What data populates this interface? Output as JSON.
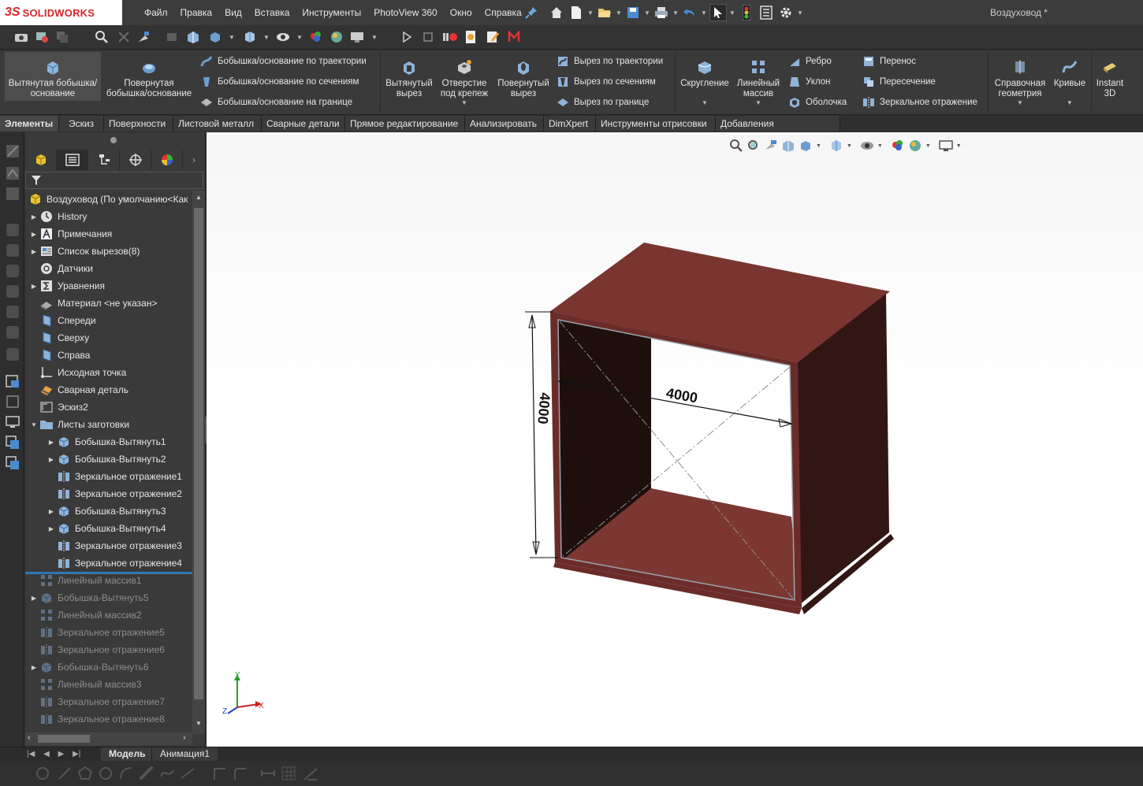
{
  "app": {
    "logo_ds": "3S",
    "logo_text": "SOLIDWORKS",
    "document_title": "Воздуховод *"
  },
  "menu": [
    "Файл",
    "Правка",
    "Вид",
    "Вставка",
    "Инструменты",
    "PhotoView 360",
    "Окно",
    "Справка"
  ],
  "ribbon": {
    "extrude_boss": "Вытянутая бобышка/основание",
    "revolve_boss": "Повернутая бобышка/основание",
    "sweep_boss": "Бобышка/основание по траектории",
    "loft_boss": "Бобышка/основание по сечениям",
    "boundary_boss": "Бобышка/основание на границе",
    "extrude_cut": "Вытянутый вырез",
    "hole_wizard": "Отверстие под крепеж",
    "revolve_cut": "Повернутый вырез",
    "sweep_cut": "Вырез по траектории",
    "loft_cut": "Вырез по сечениям",
    "boundary_cut": "Вырез по границе",
    "fillet": "Скругление",
    "linear_pattern": "Линейный массив",
    "rib": "Ребро",
    "draft": "Уклон",
    "shell": "Оболочка",
    "wrap": "Перенос",
    "intersect": "Пересечение",
    "mirror": "Зеркальное отражение",
    "ref_geometry": "Справочная геометрия",
    "curves": "Кривые",
    "instant3d": "Instant 3D"
  },
  "tabs": [
    "Элементы",
    "Эскиз",
    "Поверхности",
    "Листовой металл",
    "Сварные детали",
    "Прямое редактирование",
    "Анализировать",
    "DimXpert",
    "Инструменты отрисовки",
    "Добавления SOLIDWORKS"
  ],
  "tree": {
    "root": "Воздуховод  (По умолчанию<Как",
    "items": [
      {
        "label": "History",
        "arrow": "▶",
        "icon": "history-icon",
        "dim": false
      },
      {
        "label": "Примечания",
        "arrow": "▶",
        "icon": "annotations-icon",
        "dim": false
      },
      {
        "label": "Список вырезов(8)",
        "arrow": "▶",
        "icon": "cut-list-icon",
        "dim": false
      },
      {
        "label": "Датчики",
        "arrow": "",
        "icon": "sensors-icon",
        "dim": false
      },
      {
        "label": "Уравнения",
        "arrow": "▶",
        "icon": "equations-icon",
        "dim": false
      },
      {
        "label": "Материал <не указан>",
        "arrow": "",
        "icon": "material-icon",
        "dim": false
      },
      {
        "label": "Спереди",
        "arrow": "",
        "icon": "plane-icon",
        "dim": false
      },
      {
        "label": "Сверху",
        "arrow": "",
        "icon": "plane-icon",
        "dim": false
      },
      {
        "label": "Справа",
        "arrow": "",
        "icon": "plane-icon",
        "dim": false
      },
      {
        "label": "Исходная точка",
        "arrow": "",
        "icon": "origin-icon",
        "dim": false
      },
      {
        "label": "Сварная деталь",
        "arrow": "",
        "icon": "weldment-icon",
        "dim": false
      },
      {
        "label": "Эскиз2",
        "arrow": "",
        "icon": "sketch-icon",
        "dim": false
      },
      {
        "label": "Листы заготовки",
        "arrow": "▼",
        "icon": "folder-icon",
        "dim": false
      },
      {
        "label": "Бобышка-Вытянуть1",
        "arrow": "▶",
        "icon": "extrude-icon",
        "dim": false,
        "indent": true
      },
      {
        "label": "Бобышка-Вытянуть2",
        "arrow": "▶",
        "icon": "extrude-icon",
        "dim": false,
        "indent": true
      },
      {
        "label": "Зеркальное отражение1",
        "arrow": "",
        "icon": "mirror-icon",
        "dim": false,
        "indent": true
      },
      {
        "label": "Зеркальное отражение2",
        "arrow": "",
        "icon": "mirror-icon",
        "dim": false,
        "indent": true
      },
      {
        "label": "Бобышка-Вытянуть3",
        "arrow": "▶",
        "icon": "extrude-icon",
        "dim": false,
        "indent": true
      },
      {
        "label": "Бобышка-Вытянуть4",
        "arrow": "▶",
        "icon": "extrude-icon",
        "dim": false,
        "indent": true
      },
      {
        "label": "Зеркальное отражение3",
        "arrow": "",
        "icon": "mirror-icon",
        "dim": false,
        "indent": true
      },
      {
        "label": "Зеркальное отражение4",
        "arrow": "",
        "icon": "mirror-icon",
        "dim": false,
        "indent": true
      },
      {
        "label": "Линейный массив1",
        "arrow": "",
        "icon": "pattern-icon",
        "dim": true
      },
      {
        "label": "Бобышка-Вытянуть5",
        "arrow": "▶",
        "icon": "extrude-icon",
        "dim": true
      },
      {
        "label": "Линейный массив2",
        "arrow": "",
        "icon": "pattern-icon",
        "dim": true
      },
      {
        "label": "Зеркальное отражение5",
        "arrow": "",
        "icon": "mirror-icon",
        "dim": true
      },
      {
        "label": "Зеркальное отражение6",
        "arrow": "",
        "icon": "mirror-icon",
        "dim": true
      },
      {
        "label": "Бобышка-Вытянуть6",
        "arrow": "▶",
        "icon": "extrude-icon",
        "dim": true
      },
      {
        "label": "Линейный массив3",
        "arrow": "",
        "icon": "pattern-icon",
        "dim": true
      },
      {
        "label": "Зеркальное отражение7",
        "arrow": "",
        "icon": "mirror-icon",
        "dim": true
      },
      {
        "label": "Зеркальное отражение8",
        "arrow": "",
        "icon": "mirror-icon",
        "dim": true
      }
    ]
  },
  "model": {
    "dim_horizontal": "4000",
    "dim_vertical": "4000",
    "axis_x": "X",
    "axis_y": "Y",
    "axis_z": "Z",
    "colors": {
      "top": "#7a3531",
      "bottom": "#7c3733",
      "side_dark": "#321614",
      "inner_left": "#1e0f0d",
      "frame": "#6b2c29"
    }
  },
  "bottom_tabs": [
    "Модель",
    "Анимация1"
  ],
  "colors": {
    "titlebar": "#3c3c3c",
    "panel": "#3a3a3a",
    "accent_selected": "#2c79b5",
    "brand_red": "#d4262b"
  }
}
